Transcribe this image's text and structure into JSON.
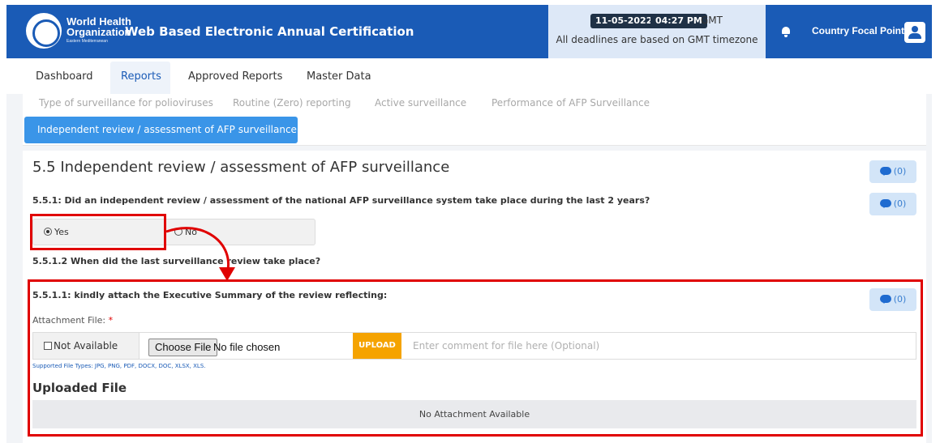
{
  "header": {
    "org_line1": "World Health",
    "org_line2": "Organization",
    "org_sub": "Eastern Mediterranean",
    "app_title": "Web Based Electronic Annual Certification",
    "date": "11-05-2022",
    "time": "04:27 PM",
    "timezone": "GMT",
    "deadline_note": "All deadlines are based on GMT timezone",
    "role": "Country Focal Point"
  },
  "nav": {
    "items": [
      "Dashboard",
      "Reports",
      "Approved Reports",
      "Master Data"
    ],
    "active": "Reports"
  },
  "subtabs": {
    "items": [
      "Type of surveillance for polioviruses",
      "Routine (Zero) reporting",
      "Active surveillance",
      "Performance of AFP Surveillance"
    ],
    "active": "Independent review / assessment of AFP surveillance"
  },
  "section": {
    "number": "5.5",
    "title": "Independent review / assessment of AFP surveillance",
    "comment_count": "(0)",
    "q1": {
      "text": "5.5.1: Did an independent review / assessment of the national AFP surveillance system take place during the last 2 years?",
      "comment_count": "(0)",
      "option_yes": "Yes",
      "option_no": "No",
      "selected": "Yes"
    },
    "q2": {
      "text": "5.5.1.2 When did the last surveillance review take place?"
    },
    "q3": {
      "text": "5.5.1.1: kindly attach the Executive Summary of the review reflecting:",
      "comment_count": "(0)",
      "attachment_label": "Attachment File:",
      "required_mark": "*",
      "not_available": "Not Available",
      "choose_file": "Choose File",
      "no_file": "No file chosen",
      "upload": "UPLOAD",
      "comment_placeholder": "Enter comment for file here (Optional)",
      "supported": "Supported File Types: JPG, PNG, PDF, DOCX, DOC, XLSX, XLS.",
      "uploaded_title": "Uploaded File",
      "no_attachment": "No Attachment Available"
    }
  },
  "colors": {
    "header_bg": "#1a5bb6",
    "active_subtab": "#3a95e8",
    "upload": "#f5a300",
    "highlight": "#e00000"
  }
}
